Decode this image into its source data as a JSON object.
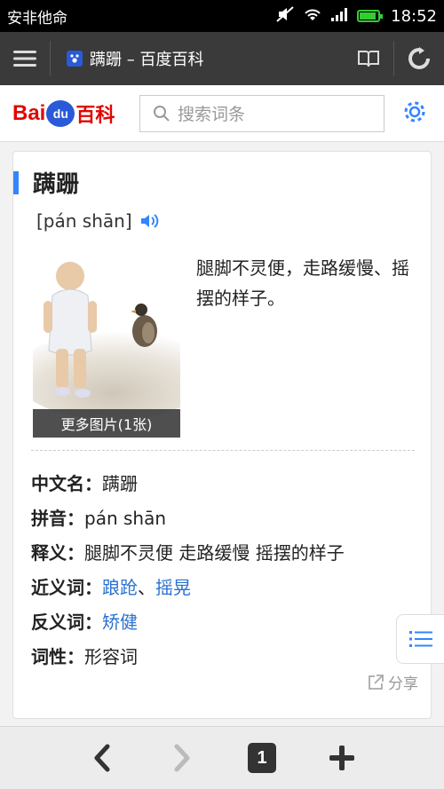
{
  "status_bar": {
    "carrier": "安非他命",
    "time": "18:52",
    "battery_level": 0.9
  },
  "browser": {
    "tab_title": "蹒跚 – 百度百科"
  },
  "header": {
    "logo_text": "Bai",
    "logo_paw": "du",
    "logo_suffix": "百科",
    "search_placeholder": "搜索词条"
  },
  "entry": {
    "title": "蹒跚",
    "pinyin": "[pán shān]",
    "more_pictures": "更多图片(1张)",
    "description": "腿脚不灵便，走路缓慢、摇摆的样子。",
    "info": [
      {
        "key": "中文名：",
        "value": "蹒跚"
      },
      {
        "key": "拼音：",
        "value": "pán shān"
      },
      {
        "key": "释义：",
        "value": "腿脚不灵便 走路缓慢 摇摆的样子"
      }
    ],
    "synonyms_label": "近义词：",
    "synonyms": [
      "踉跄",
      "摇晃"
    ],
    "synonym_separator": "、",
    "antonyms_label": "反义词：",
    "antonyms": [
      "矫健"
    ],
    "pos_label": "词性：",
    "pos_value": "形容词",
    "share_label": "分享"
  },
  "toolbar": {
    "tab_count": "1"
  },
  "colors": {
    "accent": "#3385ff",
    "link": "#2a70d0",
    "brand_red": "#e10602",
    "brand_blue": "#2a5ad8"
  }
}
